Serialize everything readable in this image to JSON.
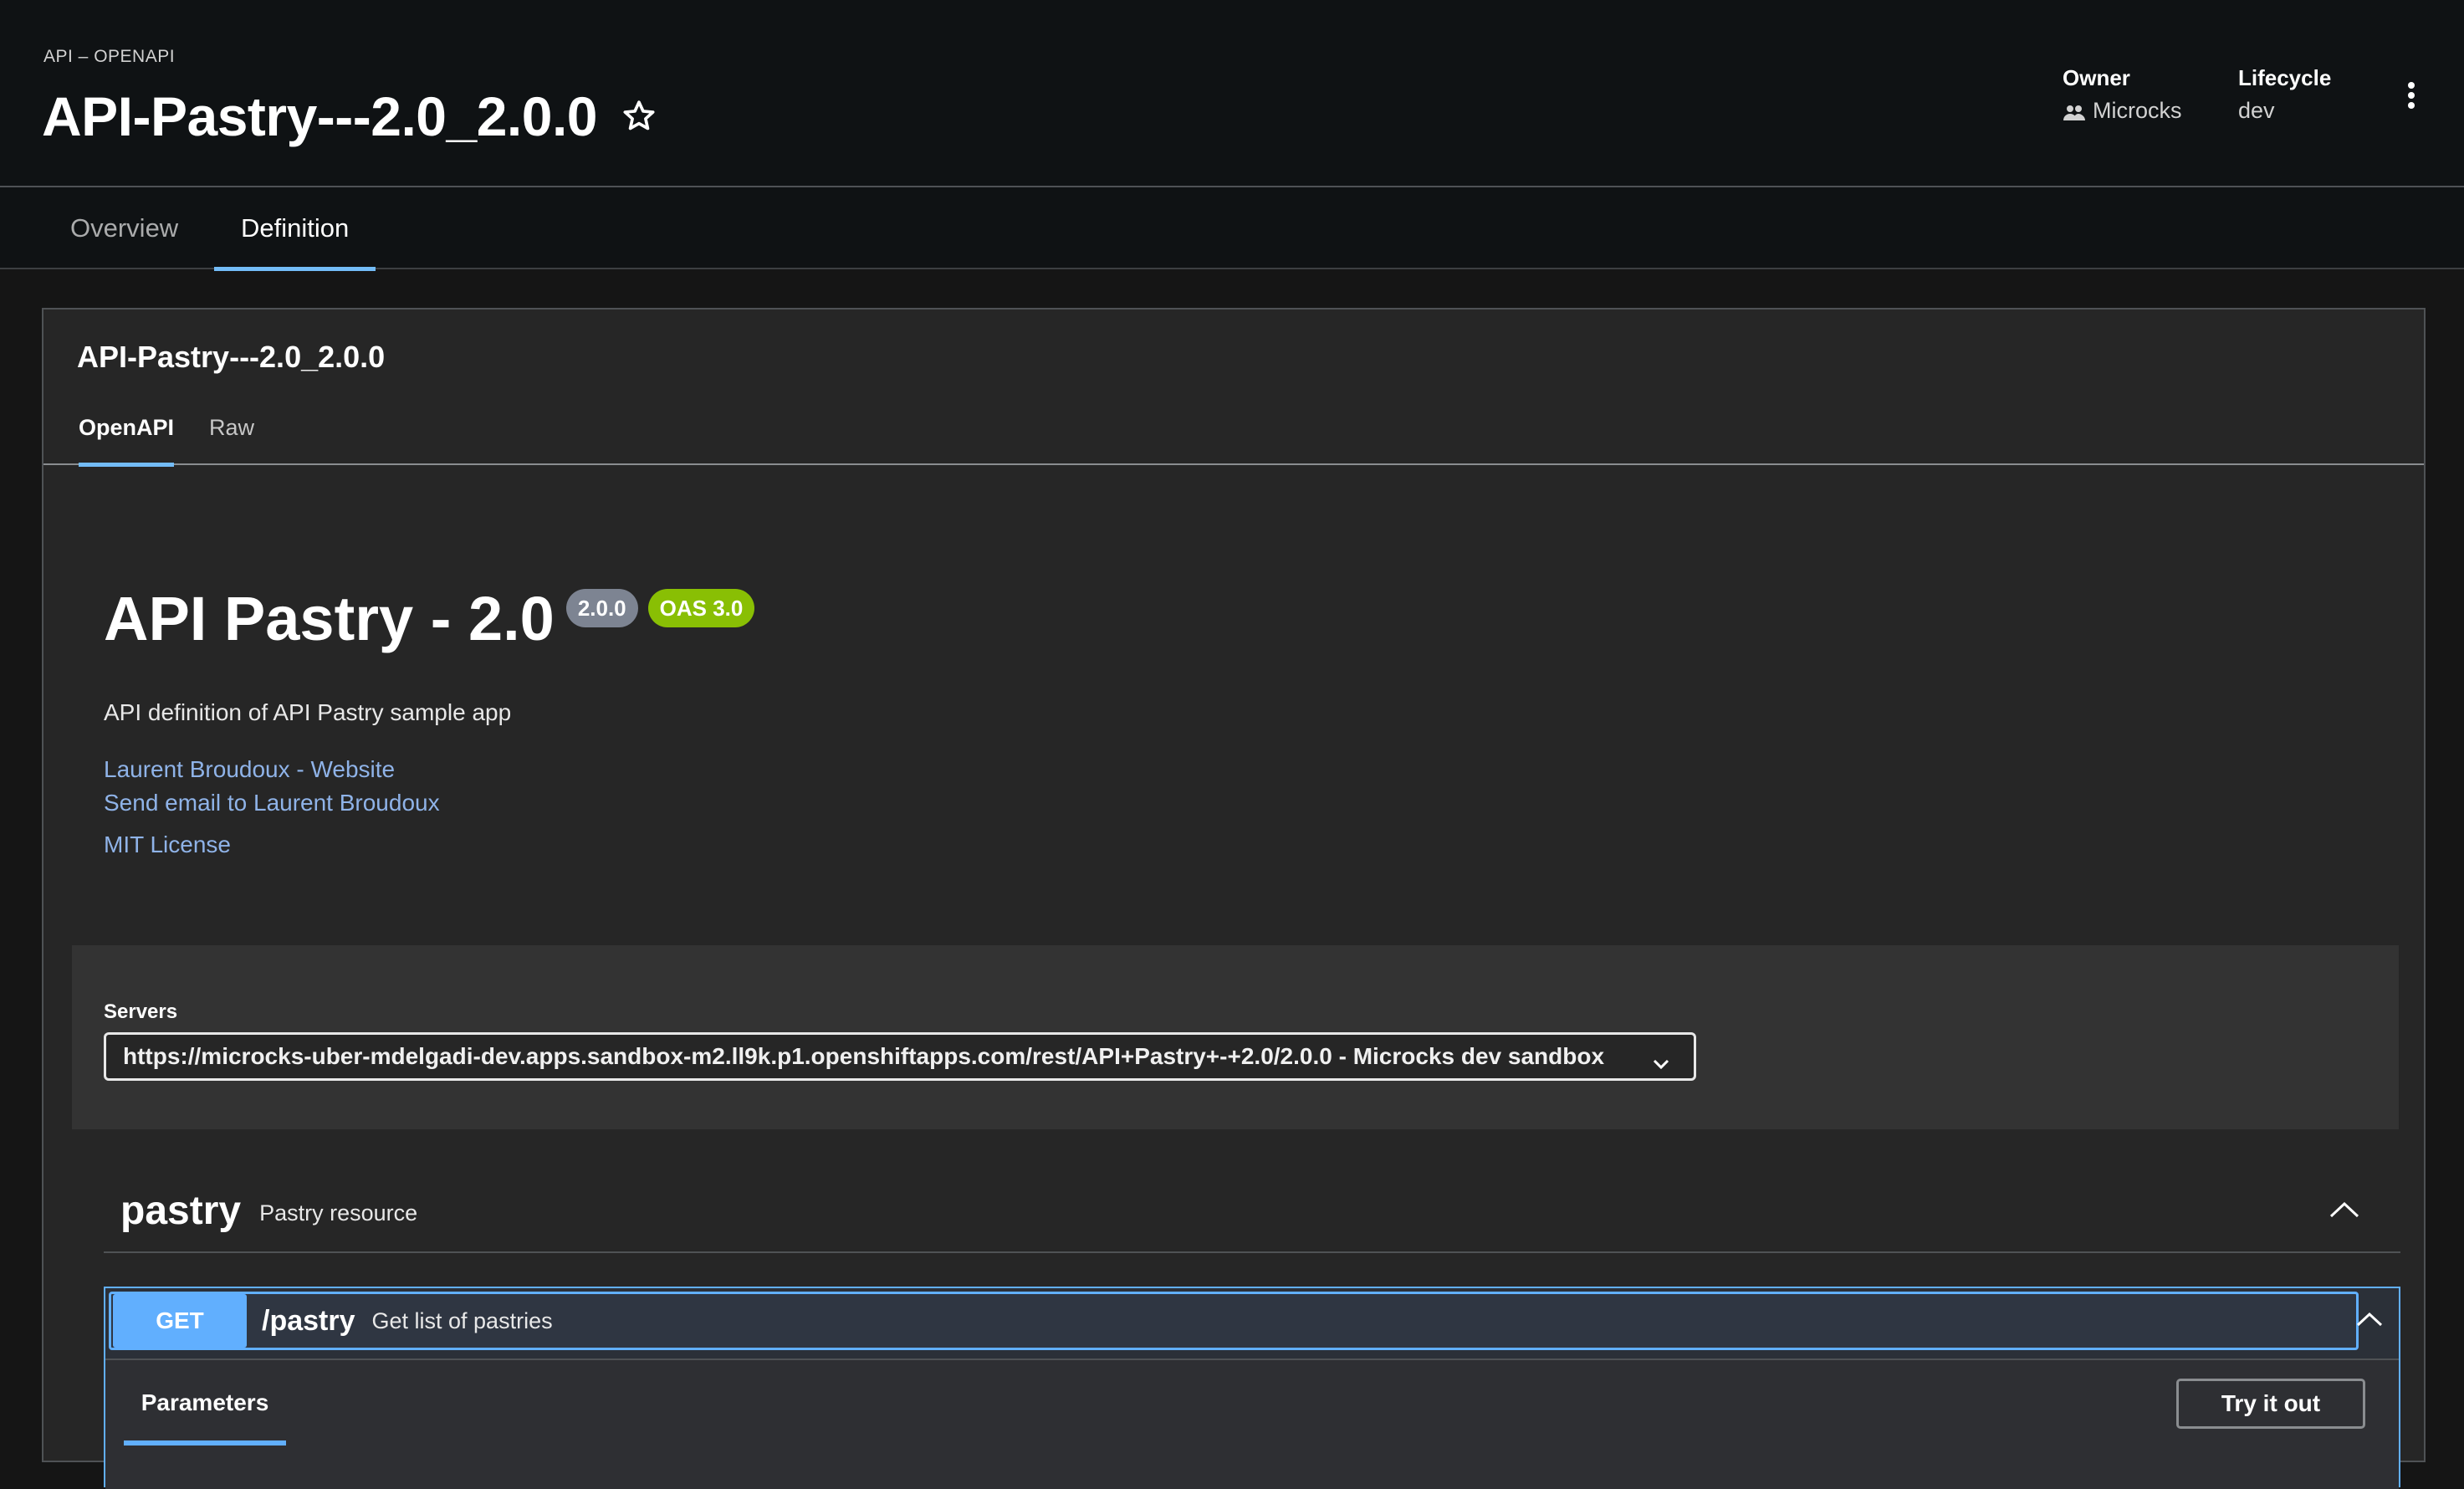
{
  "header": {
    "kind": "API – OPENAPI",
    "title": "API-Pastry---2.0_2.0.0",
    "owner_label": "Owner",
    "owner_value": "Microcks",
    "lifecycle_label": "Lifecycle",
    "lifecycle_value": "dev"
  },
  "tabs": [
    {
      "label": "Overview",
      "active": false
    },
    {
      "label": "Definition",
      "active": true
    }
  ],
  "card": {
    "title": "API-Pastry---2.0_2.0.0",
    "subtabs": [
      {
        "label": "OpenAPI",
        "active": true
      },
      {
        "label": "Raw",
        "active": false
      }
    ]
  },
  "swagger": {
    "title": "API Pastry - 2.0",
    "version_badge": "2.0.0",
    "oas_badge": "OAS 3.0",
    "description": "API definition of API Pastry sample app",
    "links": [
      "Laurent Broudoux - Website",
      "Send email to Laurent Broudoux",
      "MIT License"
    ],
    "servers_label": "Servers",
    "server_selected": "https://microcks-uber-mdelgadi-dev.apps.sandbox-m2.ll9k.p1.openshiftapps.com/rest/API+Pastry+-+2.0/2.0.0 - Microcks dev sandbox",
    "tag": {
      "name": "pastry",
      "description": "Pastry resource"
    },
    "operation": {
      "method": "GET",
      "path": "/pastry",
      "summary": "Get list of pastries",
      "params_tab": "Parameters",
      "try_button": "Try it out"
    }
  },
  "colors": {
    "accent_tab": "#73bcf7",
    "get_method": "#61affe",
    "oas_badge": "#89bf04",
    "version_badge": "#7d8492",
    "link": "#8fb3e8"
  }
}
